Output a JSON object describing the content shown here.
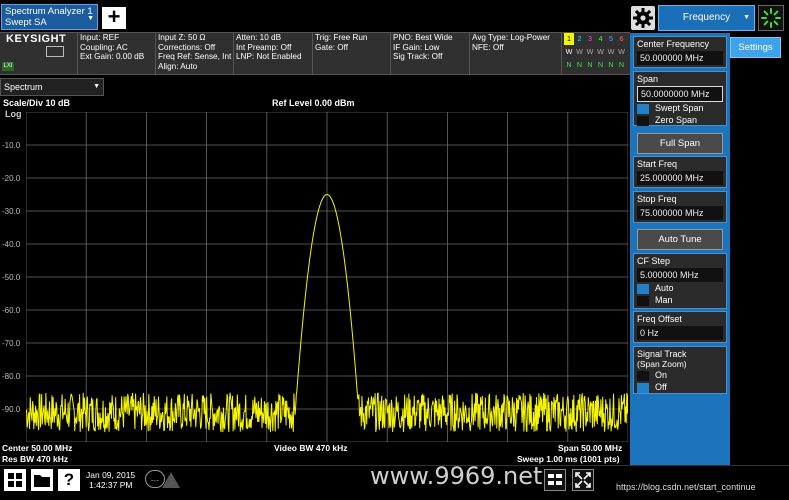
{
  "topbar": {
    "tab_line1": "Spectrum Analyzer 1",
    "tab_line2": "Swept SA",
    "add_symbol": "+",
    "freq_tab_label": "Frequency"
  },
  "brand": {
    "logo": "KEYSIGHT",
    "lxi": "LXI"
  },
  "info": {
    "col1": [
      "Input: REF",
      "Coupling: AC",
      "Ext Gain: 0.00 dB"
    ],
    "col2": [
      "Input Z: 50 Ω",
      "Corrections: Off",
      "Freq Ref: Sense, Int",
      "Align: Auto"
    ],
    "col3": [
      "Atten: 10 dB",
      "Int Preamp: Off",
      "LNP: Not Enabled"
    ],
    "col4": [
      "Trig: Free Run",
      "Gate: Off"
    ],
    "col5": [
      "PNO: Best Wide",
      "IF Gain: Low",
      "Sig Track: Off"
    ],
    "col6": [
      "Avg Type: Log-Power",
      "NFE: Off"
    ]
  },
  "traces": {
    "numbers": [
      "1",
      "2",
      "3",
      "4",
      "5",
      "6"
    ],
    "row2": [
      "W",
      "W",
      "W",
      "W",
      "W",
      "W"
    ],
    "row3": [
      "N",
      "N",
      "N",
      "N",
      "N",
      "N"
    ],
    "colors": [
      "#f5f500",
      "#00e5ff",
      "#ff40ff",
      "#40ff40",
      "#5aa0ff",
      "#ff6060"
    ]
  },
  "window": {
    "label": "Spectrum"
  },
  "plot": {
    "scale": "Scale/Div 10 dB",
    "ref": "Ref Level 0.00 dBm",
    "log": "Log",
    "yticks": [
      "-10.0",
      "-20.0",
      "-30.0",
      "-40.0",
      "-50.0",
      "-60.0",
      "-70.0",
      "-80.0",
      "-90.0"
    ],
    "center": "Center 50.00 MHz",
    "rbw": "Res BW 470 kHz",
    "vbw": "Video BW 470 kHz",
    "span": "Span 50.00 MHz",
    "sweep": "Sweep 1.00 ms (1001 pts)"
  },
  "chart_data": {
    "type": "line",
    "ref_level_dbm": 0,
    "db_per_div": 10,
    "ylim": [
      -100,
      0
    ],
    "xlim_mhz": [
      25,
      75
    ],
    "series": [
      {
        "name": "",
        "peak_x_mhz": 50,
        "peak_dbm": -25,
        "noise_floor_dbm": [
          -97,
          -85
        ],
        "color": "#f5f500"
      }
    ]
  },
  "panel": {
    "settings": "Settings",
    "center_label": "Center Frequency",
    "center_value": "50.000000 MHz",
    "span_label": "Span",
    "span_value": "50.0000000 MHz",
    "swept_span": "Swept Span",
    "zero_span": "Zero Span",
    "full_span": "Full Span",
    "start_label": "Start Freq",
    "start_value": "25.000000 MHz",
    "stop_label": "Stop Freq",
    "stop_value": "75.000000 MHz",
    "auto_tune": "Auto Tune",
    "cf_step_label": "CF Step",
    "cf_step_value": "5.000000 MHz",
    "auto": "Auto",
    "man": "Man",
    "offset_label": "Freq Offset",
    "offset_value": "0 Hz",
    "track_label": "Signal Track",
    "track_sub": "(Span Zoom)",
    "on": "On",
    "off": "Off"
  },
  "taskbar": {
    "date": "Jan 09, 2015",
    "time": "1:42:37 PM",
    "help": "?",
    "chat": "…",
    "watermark": "www.9969.net",
    "credit": "https://blog.csdn.net/start_continue"
  }
}
